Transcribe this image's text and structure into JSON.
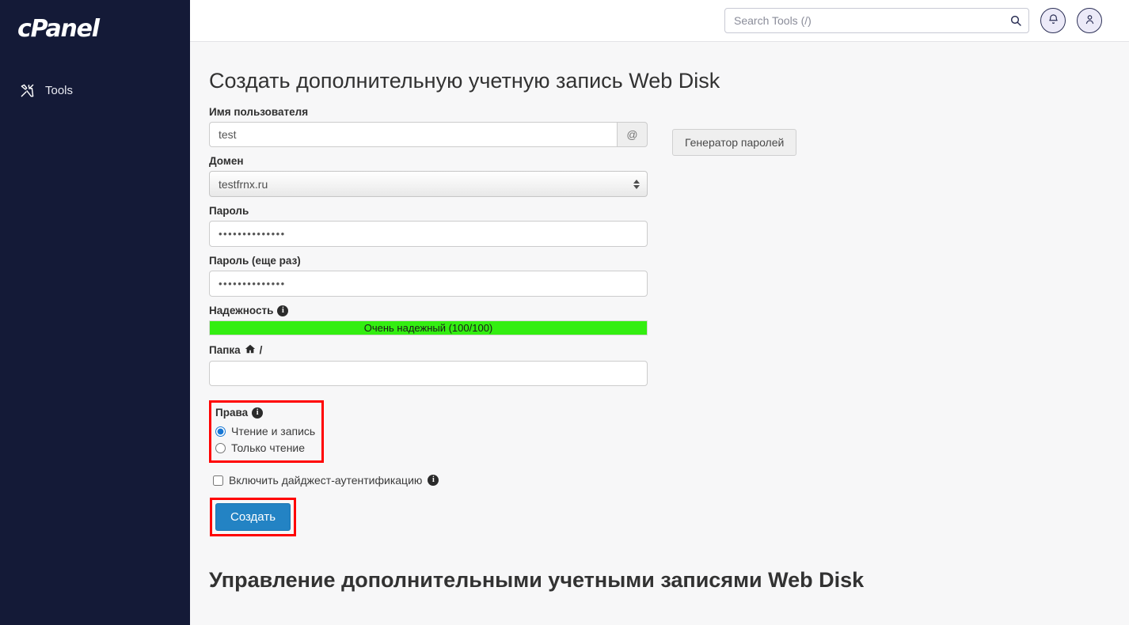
{
  "sidebar": {
    "brand": "cPanel",
    "items": [
      {
        "label": "Tools",
        "icon": "tools-icon"
      }
    ]
  },
  "header": {
    "search": {
      "placeholder": "Search Tools (/)",
      "value": "",
      "icon": "search-icon"
    },
    "notifications_icon": "bell-icon",
    "account_icon": "user-icon"
  },
  "main": {
    "page_title": "Создать дополнительную учетную запись Web Disk",
    "fields": {
      "username": {
        "label": "Имя пользователя",
        "value": "test",
        "addon": "@"
      },
      "domain": {
        "label": "Домен",
        "selected": "testfrnx.ru",
        "options": [
          "testfrnx.ru"
        ]
      },
      "password": {
        "label": "Пароль",
        "value": "••••••••••••••"
      },
      "password_again": {
        "label": "Пароль (еще раз)",
        "value": "••••••••••••••"
      },
      "strength": {
        "label": "Надежность",
        "info_icon": "info-icon",
        "bar_text": "Очень надежный (100/100)",
        "score": 100,
        "max_score": 100,
        "bar_color": "#33ee11"
      },
      "password_generator_button": "Генератор паролей",
      "directory": {
        "label": "Папка",
        "home_icon": "home-icon",
        "separator": "/",
        "value": "",
        "placeholder": ""
      },
      "permissions": {
        "label": "Права",
        "info_icon": "info-icon",
        "options": [
          {
            "label": "Чтение и запись",
            "selected": true
          },
          {
            "label": "Только чтение",
            "selected": false
          }
        ],
        "highlight_color": "#ff0000"
      },
      "digest_auth": {
        "label": "Включить дайджест-аутентификацию",
        "checked": false,
        "info_icon": "info-icon"
      }
    },
    "submit_button": {
      "label": "Создать",
      "color": "#2383c4",
      "highlight_color": "#ff0000"
    },
    "section_title": "Управление дополнительными учетными записями Web Disk"
  }
}
